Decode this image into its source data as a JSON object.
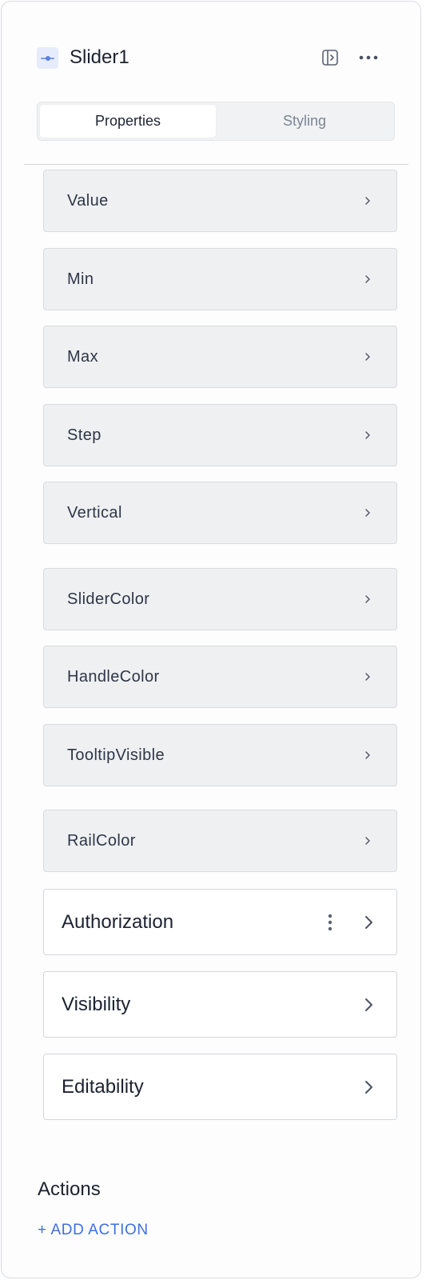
{
  "header": {
    "title": "Slider1",
    "component_icon": "slider-icon",
    "panel_icon": "panel-toggle-icon",
    "more_icon": "more-horizontal-icon"
  },
  "tabs": [
    {
      "label": "Properties",
      "active": true
    },
    {
      "label": "Styling",
      "active": false
    }
  ],
  "properties": [
    {
      "label": "Value"
    },
    {
      "label": "Min"
    },
    {
      "label": "Max"
    },
    {
      "label": "Step"
    },
    {
      "label": "Vertical"
    },
    {
      "label": "SliderColor"
    },
    {
      "label": "HandleColor"
    },
    {
      "label": "TooltipVisible"
    },
    {
      "label": "RailColor"
    }
  ],
  "sections": [
    {
      "label": "Authorization",
      "has_menu": true
    },
    {
      "label": "Visibility",
      "has_menu": false
    },
    {
      "label": "Editability",
      "has_menu": false
    }
  ],
  "actions": {
    "title": "Actions",
    "add_label": "+ ADD ACTION"
  },
  "colors": {
    "accent": "#3d6fe3",
    "row_background": "#eff0f2",
    "text": "#1c2230"
  }
}
